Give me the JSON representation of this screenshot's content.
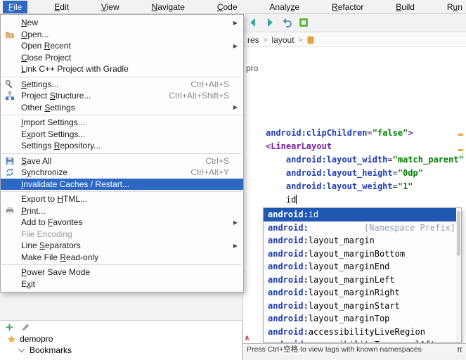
{
  "colors": {
    "menu_selection": "#2d68c4",
    "completion_selection": "#2057b0",
    "attr": "#1f3bb3",
    "value": "#008000",
    "tag": "#7b1fa2"
  },
  "menubar": {
    "items": [
      {
        "label": "File",
        "mnemonic": 0,
        "active": true
      },
      {
        "label": "Edit",
        "mnemonic": 0
      },
      {
        "label": "View",
        "mnemonic": 0
      },
      {
        "label": "Navigate",
        "mnemonic": 0
      },
      {
        "label": "Code",
        "mnemonic": 0
      },
      {
        "label": "Analyze",
        "mnemonic": 5
      },
      {
        "label": "Refactor",
        "mnemonic": 0
      },
      {
        "label": "Build",
        "mnemonic": 0
      },
      {
        "label": "Run",
        "mnemonic": 1
      }
    ]
  },
  "toolbar": {
    "icons": [
      "back-arrow-icon",
      "forward-arrow-icon",
      "undo-icon",
      "find-icon"
    ]
  },
  "breadcrumb": {
    "segments": [
      "res",
      "layout"
    ],
    "separator": ">"
  },
  "project_header_fragment": "pro",
  "file_menu": {
    "items": [
      {
        "label": "New",
        "mnemonic": 0,
        "submenu": true
      },
      {
        "label": "Open...",
        "mnemonic": 0,
        "icon": "folder-icon"
      },
      {
        "label": "Open Recent",
        "mnemonic": 5,
        "submenu": true
      },
      {
        "label": "Close Project",
        "mnemonic": 0
      },
      {
        "label": "Link C++ Project with Gradle",
        "mnemonic": 0
      },
      {
        "separator": true
      },
      {
        "label": "Settings...",
        "mnemonic": 0,
        "icon": "settings-icon",
        "shortcut": "Ctrl+Alt+S"
      },
      {
        "label": "Project Structure...",
        "mnemonic": 8,
        "icon": "project-structure-icon",
        "shortcut": "Ctrl+Alt+Shift+S"
      },
      {
        "label": "Other Settings",
        "mnemonic": 6,
        "submenu": true
      },
      {
        "separator": true
      },
      {
        "label": "Import Settings...",
        "mnemonic": 0
      },
      {
        "label": "Export Settings...",
        "mnemonic": 1
      },
      {
        "label": "Settings Repository...",
        "mnemonic": 9
      },
      {
        "separator": true
      },
      {
        "label": "Save All",
        "mnemonic": 0,
        "icon": "save-all-icon",
        "shortcut": "Ctrl+S"
      },
      {
        "label": "Synchronize",
        "mnemonic": 1,
        "icon": "synchronize-icon",
        "shortcut": "Ctrl+Alt+Y"
      },
      {
        "label": "Invalidate Caches / Restart...",
        "mnemonic": 0,
        "selected": true
      },
      {
        "separator": true
      },
      {
        "label": "Export to HTML...",
        "mnemonic": 10
      },
      {
        "label": "Print...",
        "mnemonic": 0,
        "icon": "print-icon"
      },
      {
        "label": "Add to Favorites",
        "mnemonic": 7,
        "submenu": true
      },
      {
        "label": "File Encoding",
        "disabled": true
      },
      {
        "label": "Line Separators",
        "mnemonic": 5,
        "submenu": true
      },
      {
        "label": "Make File Read-only",
        "mnemonic": 10
      },
      {
        "separator": true
      },
      {
        "label": "Power Save Mode",
        "mnemonic": 0
      },
      {
        "label": "Exit",
        "mnemonic": 1
      }
    ]
  },
  "editor": {
    "code_lines": [
      [
        {
          "t": "android:clipChildren",
          "c": "attr"
        },
        {
          "t": "=",
          "c": "eq"
        },
        {
          "t": "\"false\"",
          "c": "value"
        },
        {
          "t": ">",
          "c": "tag"
        }
      ],
      [
        {
          "t": "<LinearLayout",
          "c": "tag"
        }
      ],
      [
        {
          "t": "    ",
          "c": "plain"
        },
        {
          "t": "android:layout_width",
          "c": "attr"
        },
        {
          "t": "=",
          "c": "eq"
        },
        {
          "t": "\"match_parent\"",
          "c": "value"
        }
      ],
      [
        {
          "t": "    ",
          "c": "plain"
        },
        {
          "t": "android:layout_height",
          "c": "attr"
        },
        {
          "t": "=",
          "c": "eq"
        },
        {
          "t": "\"0dp\"",
          "c": "value"
        }
      ],
      [
        {
          "t": "    ",
          "c": "plain"
        },
        {
          "t": "android:layout_weight",
          "c": "attr"
        },
        {
          "t": "=",
          "c": "eq"
        },
        {
          "t": "\"1\"",
          "c": "value"
        }
      ],
      [
        {
          "t": "    ",
          "c": "plain"
        },
        {
          "t": "id",
          "c": "plain"
        },
        {
          "t": "",
          "c": "caret"
        }
      ]
    ],
    "gutter_mark": "∧"
  },
  "completion": {
    "items": [
      {
        "prefix": "android:",
        "name": "id",
        "selected": true
      },
      {
        "prefix": "android:",
        "name": "",
        "hint": "[Namespace Prefix]"
      },
      {
        "prefix": "android:",
        "name": "layout_margin"
      },
      {
        "prefix": "android:",
        "name": "layout_marginBottom"
      },
      {
        "prefix": "android:",
        "name": "layout_marginEnd"
      },
      {
        "prefix": "android:",
        "name": "layout_marginLeft"
      },
      {
        "prefix": "android:",
        "name": "layout_marginRight"
      },
      {
        "prefix": "android:",
        "name": "layout_marginStart"
      },
      {
        "prefix": "android:",
        "name": "layout_marginTop"
      },
      {
        "prefix": "android:",
        "name": "accessibilityLiveRegion"
      },
      {
        "prefix": "android:",
        "name": "accessibilityTraversalAfter"
      }
    ],
    "hint_bar": {
      "text": "Press Ctrl+空格 to view tags with known namespaces",
      "right_symbol": "π"
    }
  },
  "favorites": {
    "toolbar_icons": [
      "plus-icon",
      "edit-pencil-icon"
    ],
    "items": [
      {
        "icon": "star-icon",
        "label": "demopro",
        "indent": 0
      },
      {
        "icon": "chevron-down-icon",
        "label": "Bookmarks",
        "indent": 1
      }
    ]
  }
}
